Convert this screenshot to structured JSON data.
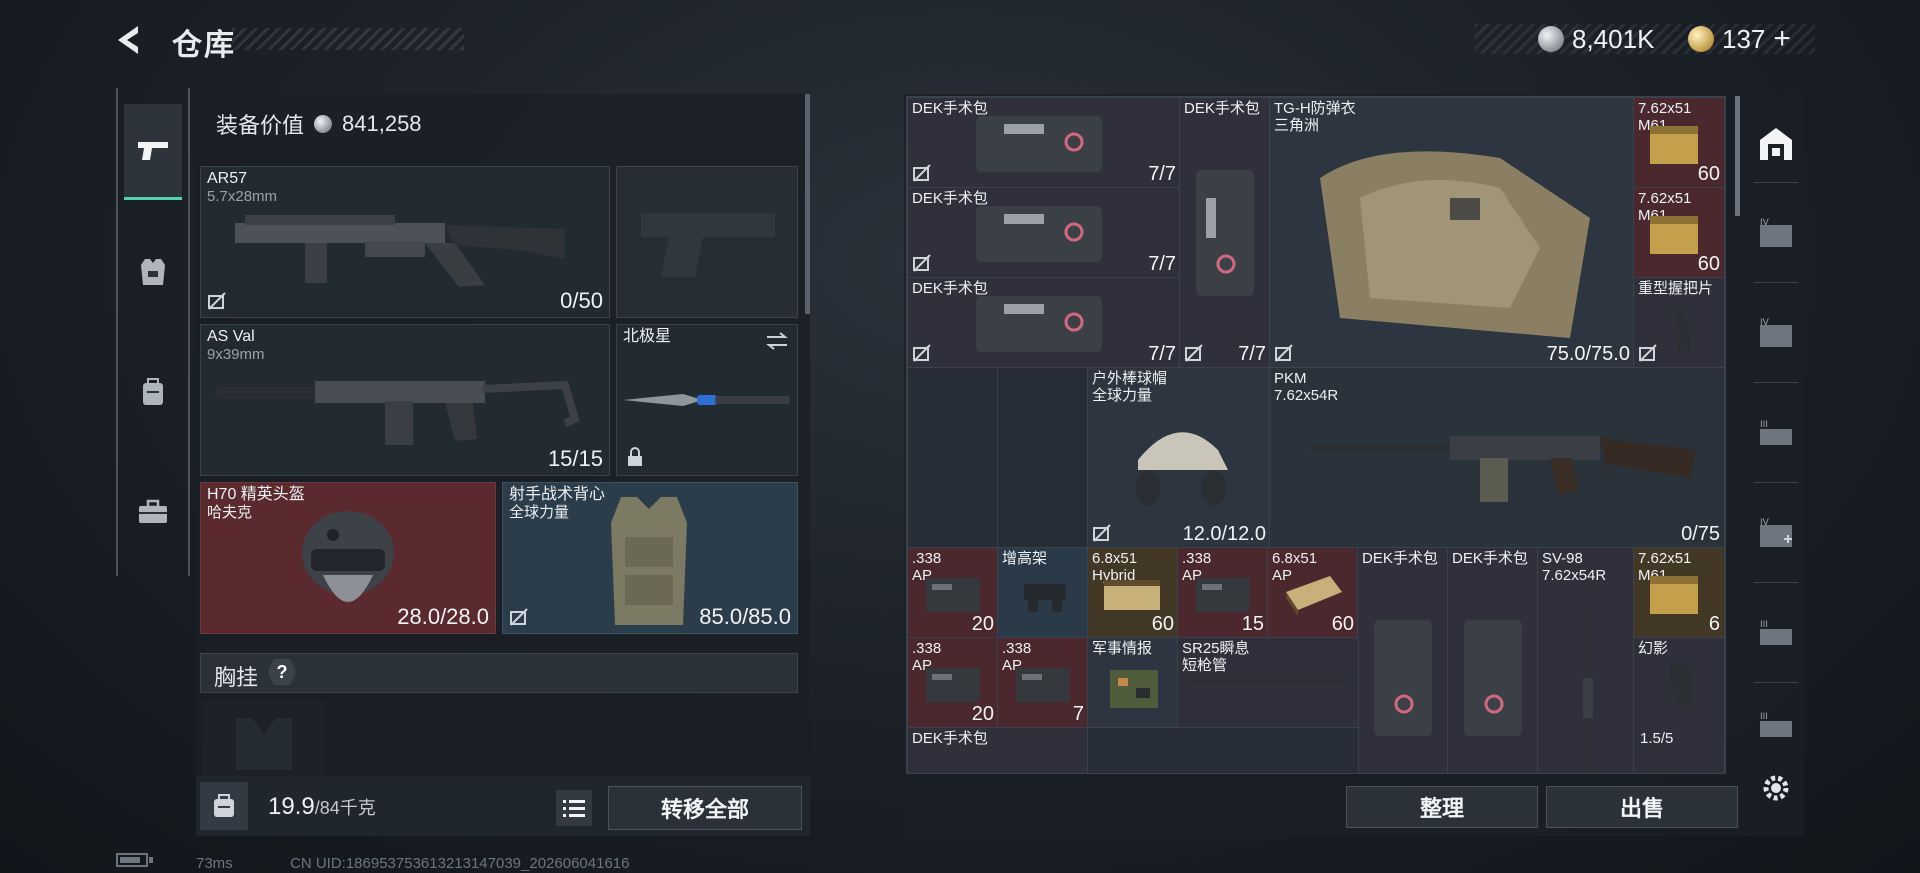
{
  "header": {
    "title": "仓库",
    "currency_silver": "8,401K",
    "currency_gold": "137",
    "add_symbol": "+"
  },
  "loadout": {
    "equipment_value_label": "装备价值",
    "equipment_value": "841,258",
    "slots": {
      "primary": {
        "name": "AR57",
        "caliber": "5.7x28mm",
        "value": "0/50"
      },
      "secondary": {
        "name": "AS Val",
        "caliber": "9x39mm",
        "value": "15/15"
      },
      "melee": {
        "name": "北极星"
      },
      "helmet": {
        "name": "H70 精英头盔",
        "sub": "哈夫克",
        "value": "28.0/28.0"
      },
      "armor": {
        "name": "射手战术背心",
        "sub": "全球力量",
        "value": "85.0/85.0"
      }
    },
    "chest_rig_label": "胸挂",
    "help_symbol": "?",
    "weight": "19.9",
    "weight_max": "/84千克",
    "transfer_all": "转移全部"
  },
  "storage": {
    "items": {
      "dek1": {
        "name": "DEK手术包",
        "value": "7/7"
      },
      "dek2": {
        "name": "DEK手术包",
        "value": "7/7"
      },
      "dek3": {
        "name": "DEK手术包",
        "value": "7/7"
      },
      "dek_tall": {
        "name": "DEK手术包",
        "value": "7/7"
      },
      "vest": {
        "name": "TG-H防弹衣",
        "sub": "三角洲",
        "value": "75.0/75.0"
      },
      "ammo762a": {
        "name": "7.62x51",
        "sub": "M61",
        "value": "60"
      },
      "ammo762b": {
        "name": "7.62x51",
        "sub": "M61",
        "value": "60"
      },
      "grip": {
        "name": "重型握把片"
      },
      "cap": {
        "name": "户外棒球帽",
        "sub": "全球力量",
        "value": "12.0/12.0"
      },
      "pkm": {
        "name": "PKM",
        "sub": "7.62x54R",
        "value": "0/75"
      },
      "ap338a": {
        "name": ".338",
        "sub": "AP",
        "value": "20"
      },
      "riser": {
        "name": "增高架"
      },
      "hybrid68a": {
        "name": "6.8x51",
        "sub": "Hybrid",
        "value": "60"
      },
      "ap338b": {
        "name": ".338",
        "sub": "AP",
        "value": "15"
      },
      "ap68": {
        "name": "6.8x51",
        "sub": "AP",
        "value": "60"
      },
      "dek5": {
        "name": "DEK手术包"
      },
      "dek6": {
        "name": "DEK手术包"
      },
      "sv98": {
        "name": "SV-98",
        "sub": "7.62x54R"
      },
      "ammo762c": {
        "name": "7.62x51",
        "sub": "M61",
        "value": "6"
      },
      "ap338c": {
        "name": ".338",
        "sub": "AP",
        "value": "20"
      },
      "ap338d": {
        "name": ".338",
        "sub": "AP",
        "value": "7"
      },
      "intel": {
        "name": "军事情报"
      },
      "sr25": {
        "name": "SR25瞬息",
        "sub": "短枪管"
      },
      "phantom": {
        "name": "幻影",
        "value": "1.5/5"
      },
      "dek7": {
        "name": "DEK手术包"
      }
    },
    "sort_button": "整理",
    "sell_button": "出售"
  },
  "status": {
    "ping": "73ms",
    "uid": "CN UID:1869537536132131470​39_202606041616"
  },
  "colors": {
    "accent": "#4fd3b0",
    "red_slot": "#5a2a2f",
    "blue_slot": "#2b3c4a"
  }
}
